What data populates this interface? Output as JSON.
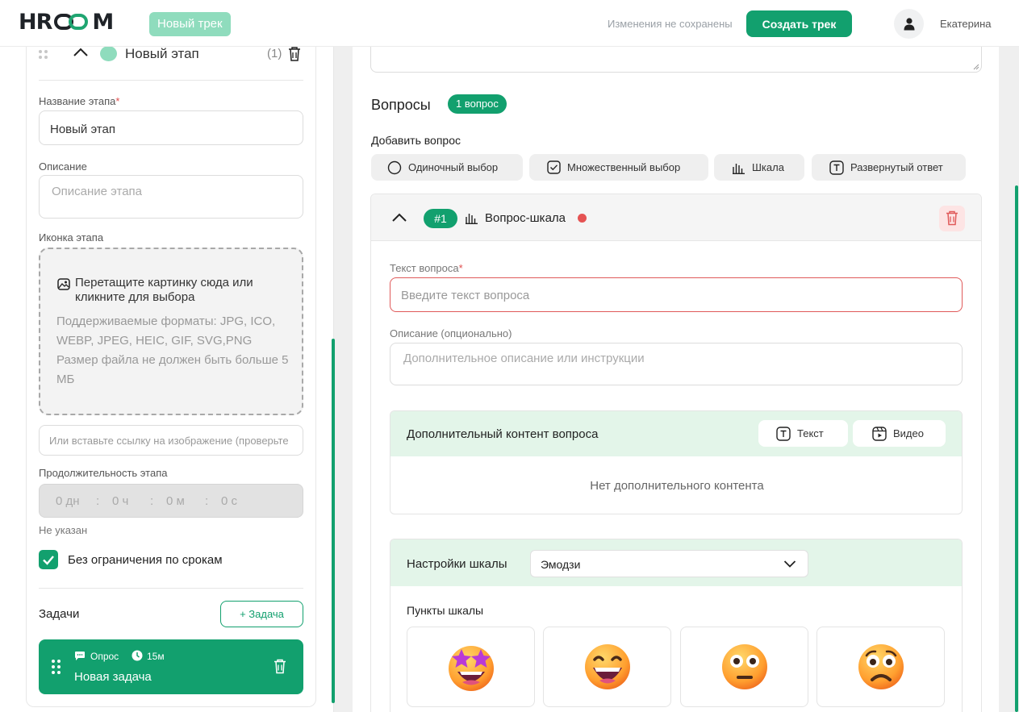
{
  "header": {
    "logo_prefix": "HR",
    "logo_suffix": "M",
    "badge": "Новый трек",
    "status": "Изменения не сохранены",
    "create_button": "Создать трек",
    "user_name": "Екатерина",
    "accent_color": "#12a06e"
  },
  "stage": {
    "title": "Новый этап",
    "count": "(1)",
    "name_label": "Название этапа",
    "required_mark": "*",
    "name_value": "Новый этап",
    "description_label": "Описание",
    "description_placeholder": "Описание этапа",
    "icon_label": "Иконка этапа",
    "dropzone_title": "Перетащите картинку сюда или кликните для выбора",
    "dropzone_formats": "Поддерживаемые форматы: JPG, ICO, WEBP, JPEG, HEIC, GIF, SVG,PNG",
    "dropzone_size": "Размер файла не должен быть больше 5 МБ",
    "url_placeholder": "Или вставьте ссылку на изображение  (проверьте",
    "duration_label": "Продолжительность этапа",
    "duration": [
      {
        "value": "0",
        "unit": "дн"
      },
      {
        "value": "0",
        "unit": "ч"
      },
      {
        "value": "0",
        "unit": "м"
      },
      {
        "value": "0",
        "unit": "с"
      }
    ],
    "duration_separator": ":",
    "duration_status": "Не указан",
    "no_deadline_label": "Без ограничения по срокам",
    "no_deadline_checked": true,
    "tasks_label": "Задачи",
    "add_task_button": "+ Задача",
    "task": {
      "type": "Опрос",
      "duration": "15м",
      "title": "Новая задача"
    }
  },
  "questions": {
    "title": "Вопросы",
    "count_badge": "1 вопрос",
    "add_label": "Добавить вопрос",
    "types": [
      {
        "label": "Одиночный выбор",
        "icon": "radio-icon"
      },
      {
        "label": "Множественный выбор",
        "icon": "checkbox-icon"
      },
      {
        "label": "Шкала",
        "icon": "bar-chart-icon"
      },
      {
        "label": "Развернутый ответ",
        "icon": "text-icon"
      }
    ],
    "item": {
      "number": "#1",
      "title": "Вопрос-шкала",
      "text_label": "Текст вопроса",
      "text_placeholder": "Введите текст вопроса",
      "description_label": "Описание (опционально)",
      "description_placeholder": "Дополнительное описание или инструкции",
      "extra_content_title": "Дополнительный контент вопроса",
      "extra_text_button": "Текст",
      "extra_video_button": "Видео",
      "no_content": "Нет дополнительного контента",
      "scale_settings_label": "Настройки шкалы",
      "scale_type": "Эмодзи",
      "scale_points_label": "Пункты шкалы",
      "scale_points": [
        "star-struck-emoji",
        "grinning-emoji",
        "neutral-emoji",
        "frowning-emoji"
      ]
    }
  }
}
